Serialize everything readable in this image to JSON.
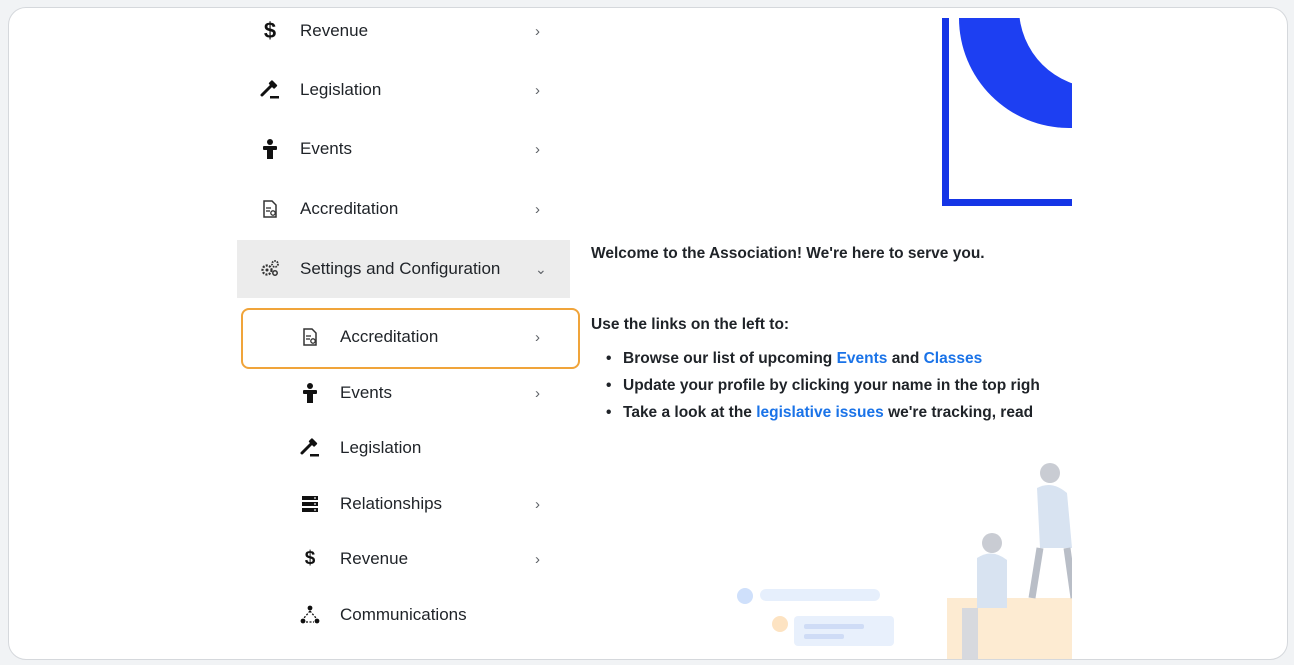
{
  "sidebar": {
    "items": [
      {
        "label": "Revenue",
        "icon": "dollar-icon",
        "chevron": "›"
      },
      {
        "label": "Legislation",
        "icon": "gavel-icon",
        "chevron": "›"
      },
      {
        "label": "Events",
        "icon": "person-podium-icon",
        "chevron": "›"
      },
      {
        "label": "Accreditation",
        "icon": "document-certificate-icon",
        "chevron": "›"
      },
      {
        "label": "Settings and Configuration",
        "icon": "gears-icon",
        "chevron": "⌄"
      }
    ],
    "subitems": [
      {
        "label": "Accreditation",
        "icon": "document-certificate-icon",
        "chevron": "›"
      },
      {
        "label": "Events",
        "icon": "person-podium-icon",
        "chevron": "›"
      },
      {
        "label": "Legislation",
        "icon": "gavel-icon",
        "chevron": ""
      },
      {
        "label": "Relationships",
        "icon": "server-rack-icon",
        "chevron": "›"
      },
      {
        "label": "Revenue",
        "icon": "dollar-icon",
        "chevron": "›"
      },
      {
        "label": "Communications",
        "icon": "network-icon",
        "chevron": ""
      }
    ]
  },
  "main": {
    "welcome": "Welcome to the Association!  We're here to serve you.",
    "use_links": "Use the links on the left to:",
    "bullets": {
      "b1_pre": "Browse our list of upcoming ",
      "b1_link1": "Events",
      "b1_mid": " and ",
      "b1_link2": "Classes",
      "b2": "Update your profile by clicking your name in the top righ",
      "b3_pre": "Take a look at the ",
      "b3_link": "legislative issues",
      "b3_post": " we're tracking, read"
    }
  },
  "colors": {
    "accent_blue": "#1d3ff2",
    "link_blue": "#1a73e8",
    "highlight_orange": "#f0a43a",
    "active_bg": "#ececec"
  }
}
